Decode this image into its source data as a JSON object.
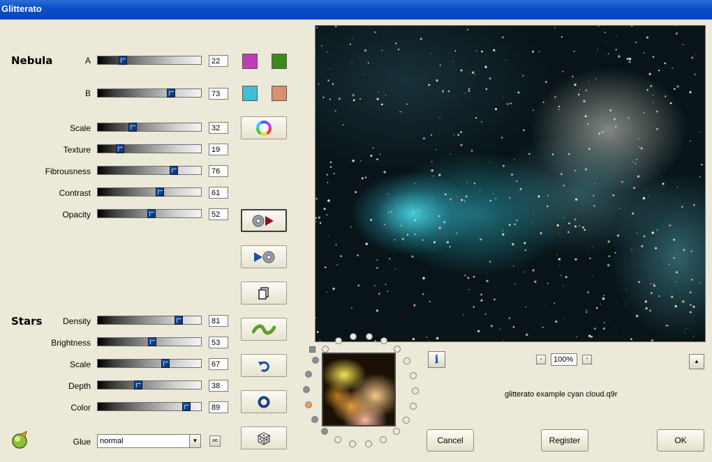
{
  "window": {
    "title": "Glitterato"
  },
  "nebula": {
    "title": "Nebula",
    "rows": [
      {
        "label": "A",
        "value": "22",
        "level": 0.22
      },
      {
        "label": "B",
        "value": "73",
        "level": 0.73
      },
      {
        "label": "Scale",
        "value": "32",
        "level": 0.32
      },
      {
        "label": "Texture",
        "value": "19",
        "level": 0.19
      },
      {
        "label": "Fibrousness",
        "value": "76",
        "level": 0.76
      },
      {
        "label": "Contrast",
        "value": "61",
        "level": 0.61
      },
      {
        "label": "Opacity",
        "value": "52",
        "level": 0.52
      }
    ],
    "swatches": {
      "a1": "#c23cb4",
      "a2": "#3b8a1e",
      "b1": "#3fbfd6",
      "b2": "#d99070"
    }
  },
  "stars": {
    "title": "Stars",
    "rows": [
      {
        "label": "Density",
        "value": "81",
        "level": 0.81
      },
      {
        "label": "Brightness",
        "value": "53",
        "level": 0.53
      },
      {
        "label": "Scale",
        "value": "67",
        "level": 0.67
      },
      {
        "label": "Depth",
        "value": "38",
        "level": 0.38
      },
      {
        "label": "Color",
        "value": "89",
        "level": 0.89
      }
    ]
  },
  "glue": {
    "label": "Glue",
    "value": "normal"
  },
  "tools": [
    {
      "name": "color-wheel-button",
      "icon": "color-wheel-icon"
    },
    {
      "name": "export-button",
      "icon": "disc-arrow-right-icon"
    },
    {
      "name": "import-button",
      "icon": "arrow-disc-icon"
    },
    {
      "name": "copy-button",
      "icon": "copy-icon"
    },
    {
      "name": "wave-button",
      "icon": "wave-icon"
    },
    {
      "name": "undo-button",
      "icon": "undo-icon"
    },
    {
      "name": "ring-button",
      "icon": "ring-icon"
    },
    {
      "name": "random-button",
      "icon": "dice-icon"
    }
  ],
  "zoom": {
    "value": "100%",
    "minus": "-",
    "plus": "+"
  },
  "file": {
    "name": "glitterato example cyan cloud.q9r"
  },
  "info": {
    "label": "i"
  },
  "buttons": {
    "cancel": "Cancel",
    "register": "Register",
    "ok": "OK"
  }
}
